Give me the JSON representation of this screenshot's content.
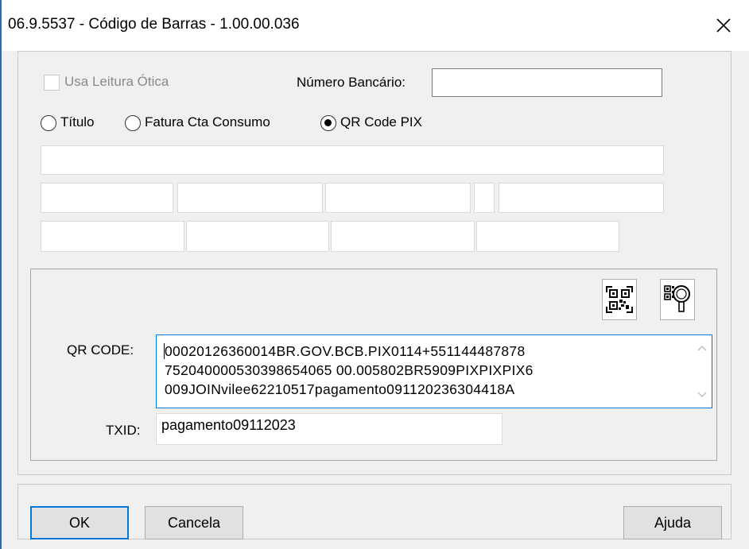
{
  "window": {
    "title": "06.9.5537 - Código de Barras - 1.00.00.036"
  },
  "options": {
    "usa_leitura_otica": "Usa Leitura Ótica",
    "numero_bancario_label": "Número Bancário:",
    "numero_bancario_value": ""
  },
  "radios": [
    {
      "label": "Título",
      "selected": false
    },
    {
      "label": "Fatura Cta Consumo",
      "selected": false
    },
    {
      "label": "QR Code PIX",
      "selected": true
    }
  ],
  "qr": {
    "qr_code_label": "QR CODE:",
    "qr_code_lines": [
      "00020126360014BR.GOV.BCB.PIX0114+551144487878",
      "752040000530398654065 00.005802BR5909PIXPIXPIX6",
      "009JOINvilee62210517pagamento091120236304418A"
    ],
    "txid_label": "TXID:",
    "txid_value": "pagamento09112023",
    "icons": [
      "qr-scan-icon",
      "qr-search-icon"
    ]
  },
  "buttons": {
    "ok": "OK",
    "cancela": "Cancela",
    "ajuda": "Ajuda"
  },
  "colors": {
    "focus": "#0078d7",
    "window_bg": "#f0f0f0"
  }
}
